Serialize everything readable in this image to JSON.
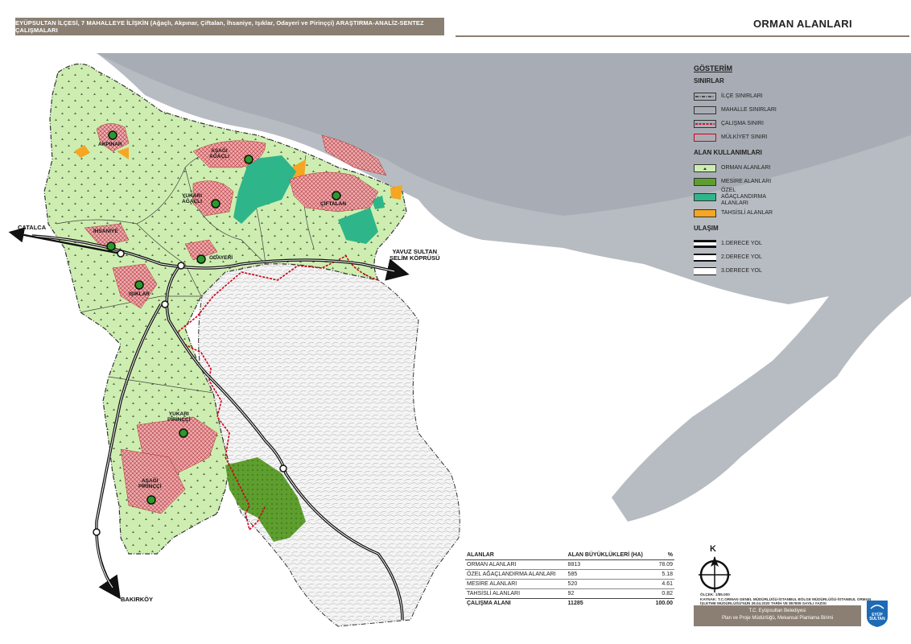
{
  "header": {
    "subtitle": "EYÜPSULTAN İLÇESİ, 7 MAHALLEYE İLİŞKİN (Ağaçlı, Akpınar, Çiftalan, İhsaniye, Işıklar, Odayeri ve Pirinççi) ARAŞTIRMA-ANALİZ-SENTEZ ÇALIŞMALARI",
    "title": "ORMAN ALANLARI"
  },
  "legend": {
    "title": "GÖSTERİM",
    "sections": [
      {
        "heading": "SINIRLAR",
        "items": [
          {
            "label": "İLÇE SINIRLARI",
            "style": "district"
          },
          {
            "label": "MAHALLE SINIRLARI",
            "style": "neighborhood"
          },
          {
            "label": "ÇALIŞMA SINIRI",
            "style": "study"
          },
          {
            "label": "MÜLKİYET SINIRI",
            "style": "property"
          }
        ]
      },
      {
        "heading": "ALAN KULLANIMLARI",
        "items": [
          {
            "label": "ORMAN ALANLARI",
            "style": "forest"
          },
          {
            "label": "MESİRE ALANLARI",
            "style": "recreation"
          },
          {
            "label": "ÖZEL AĞAÇLANDIRMA ALANLARI",
            "style": "afforestation"
          },
          {
            "label": "TAHSİSLİ ALANLAR",
            "style": "allocated"
          }
        ]
      },
      {
        "heading": "ULAŞIM",
        "items": [
          {
            "label": "1.DERECE YOL",
            "style": "road1"
          },
          {
            "label": "2.DERECE YOL",
            "style": "road2"
          },
          {
            "label": "3.DERECE YOL",
            "style": "road3"
          }
        ]
      }
    ]
  },
  "colors": {
    "forest": "#cdeeb0",
    "recreation": "#5e9e2e",
    "afforestation": "#2fb58a",
    "allocated": "#f5a623",
    "study_boundary": "#d0021b",
    "sea": "#b7bcc2",
    "header": "#8a7f72"
  },
  "places": {
    "akpinar": "AKPINAR",
    "agacli": "AŞAĞI\nAĞAÇLI",
    "yukari_agacli": "YUKARI\nAĞAÇLI",
    "ciftalan": "ÇİFTALAN",
    "ihsaniye": "İHSANİYE",
    "odayeri": "ODAYERİ",
    "isiklar": "IŞIKLAR",
    "yukari_pirincci": "YUKARI\nPİRİNÇÇİ",
    "asagi_pirincci": "AŞAĞI\nPİRİNÇÇİ",
    "catalca": "ÇATALCA",
    "yavuz": "YAVUZ SULTAN\nSELİM KÖPRÜSÜ",
    "bakirkoy": "BAKIRKÖY"
  },
  "stats": {
    "headers": [
      "ALANLAR",
      "ALAN BÜYÜKLÜKLERİ (HA)",
      "%"
    ],
    "rows": [
      [
        "ORMAN ALANLARI",
        "8813",
        "78.09"
      ],
      [
        "ÖZEL AĞAÇLANDIRMA ALANLARI",
        "585",
        "5.18"
      ],
      [
        "MESİRE ALANLARI",
        "520",
        "4.61"
      ],
      [
        "TAHSİSLİ ALANLARI",
        "92",
        "0.82"
      ]
    ],
    "total": [
      "ÇALIŞMA ALANI",
      "11285",
      "100.00"
    ]
  },
  "compass_letter": "K",
  "scale": "ÖLÇEK: 1/85.000",
  "source": "KAYNAK: T.C.ORMAN GENEL MÜDÜRLÜĞÜ-İSTANBUL BÖLGE MÜDÜRLÜĞÜ-İSTANBUL ORMAN İŞLETME MÜDÜRLÜĞÜ'NÜN 28.04.2020 TARİH VE 857809 SAYILI YAZISI",
  "footer": {
    "line1": "T.C. Eyüpsultan Belediyesi",
    "line2": "Plan ve Proje Müdürlüğü, Mekansal Planlama Birimi"
  },
  "logo_text": "EYÜP SULTAN"
}
